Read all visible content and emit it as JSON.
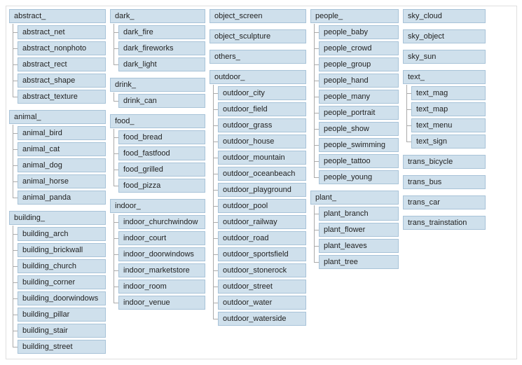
{
  "columns": [
    [
      {
        "label": "abstract_",
        "children": [
          "abstract_net",
          "abstract_nonphoto",
          "abstract_rect",
          "abstract_shape",
          "abstract_texture"
        ]
      },
      {
        "label": "animal_",
        "children": [
          "animal_bird",
          "animal_cat",
          "animal_dog",
          "animal_horse",
          "animal_panda"
        ]
      },
      {
        "label": "building_",
        "children": [
          "building_arch",
          "building_brickwall",
          "building_church",
          "building_corner",
          "building_doorwindows",
          "building_pillar",
          "building_stair",
          "building_street"
        ]
      }
    ],
    [
      {
        "label": "dark_",
        "children": [
          "dark_fire",
          "dark_fireworks",
          "dark_light"
        ]
      },
      {
        "label": "drink_",
        "children": [
          "drink_can"
        ]
      },
      {
        "label": "food_",
        "children": [
          "food_bread",
          "food_fastfood",
          "food_grilled",
          "food_pizza"
        ]
      },
      {
        "label": "indoor_",
        "children": [
          "indoor_churchwindow",
          "indoor_court",
          "indoor_doorwindows",
          "indoor_marketstore",
          "indoor_room",
          "indoor_venue"
        ]
      }
    ],
    [
      {
        "label": "object_screen"
      },
      {
        "label": "object_sculpture"
      },
      {
        "label": "others_"
      },
      {
        "label": "outdoor_",
        "children": [
          "outdoor_city",
          "outdoor_field",
          "outdoor_grass",
          "outdoor_house",
          "outdoor_mountain",
          "outdoor_oceanbeach",
          "outdoor_playground",
          "outdoor_pool",
          "outdoor_railway",
          "outdoor_road",
          "outdoor_sportsfield",
          "outdoor_stonerock",
          "outdoor_street",
          "outdoor_water",
          "outdoor_waterside"
        ]
      }
    ],
    [
      {
        "label": "people_",
        "children": [
          "people_baby",
          "people_crowd",
          "people_group",
          "people_hand",
          "people_many",
          "people_portrait",
          "people_show",
          "people_swimming",
          "people_tattoo",
          "people_young"
        ]
      },
      {
        "label": "plant_",
        "children": [
          "plant_branch",
          "plant_flower",
          "plant_leaves",
          "plant_tree"
        ]
      }
    ],
    [
      {
        "label": "sky_cloud"
      },
      {
        "label": "sky_object"
      },
      {
        "label": "sky_sun"
      },
      {
        "label": "text_",
        "children": [
          "text_mag",
          "text_map",
          "text_menu",
          "text_sign"
        ]
      },
      {
        "label": "trans_bicycle"
      },
      {
        "label": "trans_bus"
      },
      {
        "label": "trans_car"
      },
      {
        "label": "trans_trainstation"
      }
    ]
  ]
}
